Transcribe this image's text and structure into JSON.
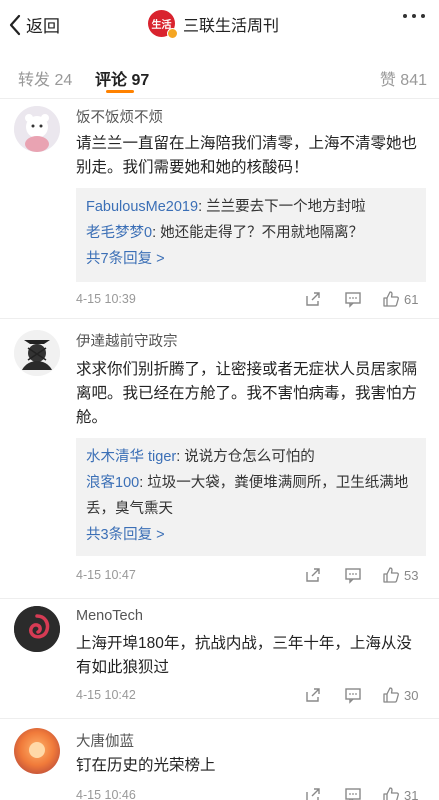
{
  "header": {
    "back_label": "返回",
    "logo_text": "生活",
    "title": "三联生活周刊"
  },
  "tabs": {
    "repost": "转发 24",
    "comment": "评论 97",
    "like": "赞 841"
  },
  "comments": [
    {
      "name": "饭不饭烦不烦",
      "text": "请兰兰一直留在上海陪我们清零，上海不清零她也别走。我们需要她和她的核酸码！",
      "replies": [
        {
          "user": "FabulousMe2019",
          "text": ": 兰兰要去下一个地方封啦"
        },
        {
          "user": "老毛梦梦0",
          "text": ": 她还能走得了？不用就地隔离？"
        }
      ],
      "more_replies": "共7条回复 >",
      "time": "4-15 10:39",
      "likes": "61"
    },
    {
      "name": "伊達越前守政宗",
      "text": "求求你们别折腾了，让密接或者无症状人员居家隔离吧。我已经在方舱了。我不害怕病毒，我害怕方舱。",
      "replies": [
        {
          "user": "水木清华 tiger",
          "text": ": 说说方仓怎么可怕的"
        },
        {
          "user": "浪客100",
          "text": ": 垃圾一大袋，粪便堆满厕所，卫生纸满地丢，臭气熏天"
        }
      ],
      "more_replies": "共3条回复 >",
      "time": "4-15 10:47",
      "likes": "53"
    },
    {
      "name": "MenoTech",
      "text": "上海开埠180年，抗战内战，三年十年，上海从没有如此狼狈过",
      "time": "4-15 10:42",
      "likes": "30"
    },
    {
      "name": "大唐伽蓝",
      "text": "钉在历史的光荣榜上",
      "time": "4-15 10:46",
      "likes": "31"
    }
  ],
  "icons": {
    "back": "chevron-left-icon",
    "more": "more-dots-icon",
    "share": "share-icon",
    "reply": "comment-icon",
    "like": "thumbs-up-icon"
  },
  "colors": {
    "accent": "#ff8200",
    "link": "#3b6fb6",
    "reply_bg": "#f2f2f2",
    "logo_red": "#d9232e"
  }
}
